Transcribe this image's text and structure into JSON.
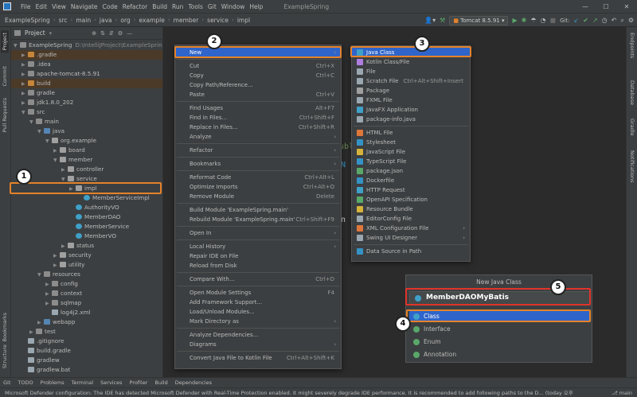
{
  "menubar": {
    "items": [
      "File",
      "Edit",
      "View",
      "Navigate",
      "Code",
      "Refactor",
      "Build",
      "Run",
      "Tools",
      "Git",
      "Window",
      "Help"
    ],
    "project_title": "ExampleSpring"
  },
  "navbar": {
    "crumbs": [
      "ExampleSpring",
      "src",
      "main",
      "java",
      "org",
      "example",
      "member",
      "service",
      "impl"
    ]
  },
  "toolbar": {
    "run_config": "Tomcat 8.5.91",
    "git_label": "Git:"
  },
  "left_stripe": [
    "Project",
    "Commit",
    "Pull Requests",
    "Bookmarks",
    "Structure"
  ],
  "right_stripe": [
    "Endpoints",
    "Database",
    "Gradle",
    "Notifications"
  ],
  "project_panel": {
    "title": "Project",
    "tree": [
      {
        "label": "ExampleSpring",
        "extra": "D:\\IntelliJProject\\ExampleSpring",
        "depth": 0,
        "icon": "folder",
        "open": true
      },
      {
        "label": ".gradle",
        "depth": 1,
        "icon": "orange",
        "open": false
      },
      {
        "label": ".idea",
        "depth": 1,
        "icon": "folder",
        "open": false
      },
      {
        "label": "apache-tomcat-8.5.91",
        "depth": 1,
        "icon": "folder",
        "open": false
      },
      {
        "label": "build",
        "depth": 1,
        "icon": "orange",
        "open": false
      },
      {
        "label": "gradle",
        "depth": 1,
        "icon": "folder",
        "open": false
      },
      {
        "label": "jdk1.8.0_202",
        "depth": 1,
        "icon": "folder",
        "open": false
      },
      {
        "label": "src",
        "depth": 1,
        "icon": "folder",
        "open": true
      },
      {
        "label": "main",
        "depth": 2,
        "icon": "folder",
        "open": true
      },
      {
        "label": "java",
        "depth": 3,
        "icon": "blue",
        "open": true
      },
      {
        "label": "org.example",
        "depth": 4,
        "icon": "pkg",
        "open": true
      },
      {
        "label": "board",
        "depth": 5,
        "icon": "pkg",
        "open": false
      },
      {
        "label": "member",
        "depth": 5,
        "icon": "pkg",
        "open": true
      },
      {
        "label": "controller",
        "depth": 6,
        "icon": "pkg",
        "open": false
      },
      {
        "label": "service",
        "depth": 6,
        "icon": "pkg",
        "open": true
      },
      {
        "label": "impl",
        "depth": 7,
        "icon": "pkg",
        "open": false,
        "selected": true
      },
      {
        "label": "MemberServiceImpl",
        "depth": 8,
        "icon": "class",
        "leaf": true
      },
      {
        "label": "AuthorityVO",
        "depth": 7,
        "icon": "class",
        "leaf": true
      },
      {
        "label": "MemberDAO",
        "depth": 7,
        "icon": "class",
        "leaf": true
      },
      {
        "label": "MemberService",
        "depth": 7,
        "icon": "class",
        "leaf": true
      },
      {
        "label": "MemberVO",
        "depth": 7,
        "icon": "class",
        "leaf": true
      },
      {
        "label": "status",
        "depth": 6,
        "icon": "pkg",
        "open": false
      },
      {
        "label": "security",
        "depth": 5,
        "icon": "pkg",
        "open": false
      },
      {
        "label": "utility",
        "depth": 5,
        "icon": "pkg",
        "open": false
      },
      {
        "label": "resources",
        "depth": 3,
        "icon": "folder",
        "open": true
      },
      {
        "label": "config",
        "depth": 4,
        "icon": "folder",
        "open": false
      },
      {
        "label": "context",
        "depth": 4,
        "icon": "folder",
        "open": false
      },
      {
        "label": "sqlmap",
        "depth": 4,
        "icon": "folder",
        "open": false
      },
      {
        "label": "log4j2.xml",
        "depth": 4,
        "icon": "file",
        "leaf": true
      },
      {
        "label": "webapp",
        "depth": 3,
        "icon": "blue",
        "open": false
      },
      {
        "label": "test",
        "depth": 2,
        "icon": "folder",
        "open": false
      },
      {
        "label": ".gitignore",
        "depth": 1,
        "icon": "file",
        "leaf": true
      },
      {
        "label": "build.gradle",
        "depth": 1,
        "icon": "file",
        "leaf": true
      },
      {
        "label": "gradlew",
        "depth": 1,
        "icon": "file",
        "leaf": true
      },
      {
        "label": "gradlew.bat",
        "depth": 1,
        "icon": "file",
        "leaf": true
      }
    ]
  },
  "context_menu": {
    "items": [
      {
        "label": "New",
        "arrow": true,
        "selected": true
      },
      {
        "sep": true
      },
      {
        "label": "Cut",
        "shortcut": "Ctrl+X"
      },
      {
        "label": "Copy",
        "shortcut": "Ctrl+C"
      },
      {
        "label": "Copy Path/Reference..."
      },
      {
        "label": "Paste",
        "shortcut": "Ctrl+V"
      },
      {
        "sep": true
      },
      {
        "label": "Find Usages",
        "shortcut": "Alt+F7"
      },
      {
        "label": "Find in Files...",
        "shortcut": "Ctrl+Shift+F"
      },
      {
        "label": "Replace in Files...",
        "shortcut": "Ctrl+Shift+R"
      },
      {
        "label": "Analyze",
        "arrow": true
      },
      {
        "sep": true
      },
      {
        "label": "Refactor",
        "arrow": true
      },
      {
        "sep": true
      },
      {
        "label": "Bookmarks",
        "arrow": true
      },
      {
        "sep": true
      },
      {
        "label": "Reformat Code",
        "shortcut": "Ctrl+Alt+L"
      },
      {
        "label": "Optimize Imports",
        "shortcut": "Ctrl+Alt+O"
      },
      {
        "label": "Remove Module",
        "shortcut": "Delete"
      },
      {
        "sep": true
      },
      {
        "label": "Build Module 'ExampleSpring.main'"
      },
      {
        "label": "Rebuild Module 'ExampleSpring.main'",
        "shortcut": "Ctrl+Shift+F9"
      },
      {
        "sep": true
      },
      {
        "label": "Open In",
        "arrow": true
      },
      {
        "sep": true
      },
      {
        "label": "Local History",
        "arrow": true
      },
      {
        "label": "Repair IDE on File"
      },
      {
        "label": "Reload from Disk"
      },
      {
        "sep": true
      },
      {
        "label": "Compare With...",
        "shortcut": "Ctrl+D"
      },
      {
        "sep": true
      },
      {
        "label": "Open Module Settings",
        "shortcut": "F4"
      },
      {
        "label": "Add Framework Support..."
      },
      {
        "label": "Load/Unload Modules..."
      },
      {
        "label": "Mark Directory as",
        "arrow": true
      },
      {
        "sep": true
      },
      {
        "label": "Analyze Dependencies..."
      },
      {
        "label": "Diagrams",
        "arrow": true
      },
      {
        "sep": true
      },
      {
        "label": "Convert Java File to Kotlin File",
        "shortcut": "Ctrl+Alt+Shift+K"
      }
    ]
  },
  "new_submenu": {
    "items": [
      {
        "label": "Java Class",
        "color": "#3fa0c8",
        "selected": true
      },
      {
        "label": "Kotlin Class/File",
        "color": "#b07de0"
      },
      {
        "label": "File",
        "color": "#9aa7b0"
      },
      {
        "label": "Scratch File",
        "shortcut": "Ctrl+Alt+Shift+Insert",
        "color": "#9aa7b0"
      },
      {
        "label": "Package",
        "color": "#a0a0a0"
      },
      {
        "label": "FXML File",
        "color": "#9aa7b0"
      },
      {
        "label": "JavaFX Application",
        "color": "#3fa0c8"
      },
      {
        "label": "package-info.java",
        "color": "#9aa7b0"
      },
      {
        "sep": true
      },
      {
        "label": "HTML File",
        "color": "#e0773a"
      },
      {
        "label": "Stylesheet",
        "color": "#3592c4"
      },
      {
        "label": "JavaScript File",
        "color": "#d6b33a"
      },
      {
        "label": "TypeScript File",
        "color": "#3592c4"
      },
      {
        "label": "package.json",
        "color": "#59a869"
      },
      {
        "label": "Dockerfile",
        "color": "#3592c4"
      },
      {
        "label": "HTTP Request",
        "color": "#3fa0c8"
      },
      {
        "label": "OpenAPI Specification",
        "color": "#59a869"
      },
      {
        "label": "Resource Bundle",
        "color": "#d6b33a"
      },
      {
        "label": "EditorConfig File",
        "color": "#9aa7b0"
      },
      {
        "label": "XML Configuration File",
        "arrow": true,
        "color": "#e0773a"
      },
      {
        "label": "Swing UI Designer",
        "arrow": true,
        "color": "#9aa7b0"
      },
      {
        "sep": true
      },
      {
        "label": "Data Source in Path",
        "color": "#3592c4"
      }
    ]
  },
  "dialog": {
    "title": "New Java Class",
    "name_value": "MemberDAOMyBatis",
    "options": [
      {
        "label": "Class",
        "color": "#3fa0c8",
        "selected": true
      },
      {
        "label": "Interface",
        "color": "#59a869"
      },
      {
        "label": "Enum",
        "color": "#59a869"
      },
      {
        "label": "Annotation",
        "color": "#59a869"
      }
    ]
  },
  "badges": [
    "1",
    "2",
    "3",
    "4",
    "5"
  ],
  "bottom_tabs": [
    "Git",
    "TODO",
    "Problems",
    "Terminal",
    "Services",
    "Profiler",
    "Build",
    "Dependencies"
  ],
  "statusbar": {
    "message": "Microsoft Defender configuration: The IDE has detected Microsoft Defender with Real-Time Protection enabled. It might severely degrade IDE performance. It is recommended to add following paths to the D... (today 오후",
    "branch": "main"
  },
  "editor_fragments": [
    "ubl",
    "N",
    "n t"
  ]
}
